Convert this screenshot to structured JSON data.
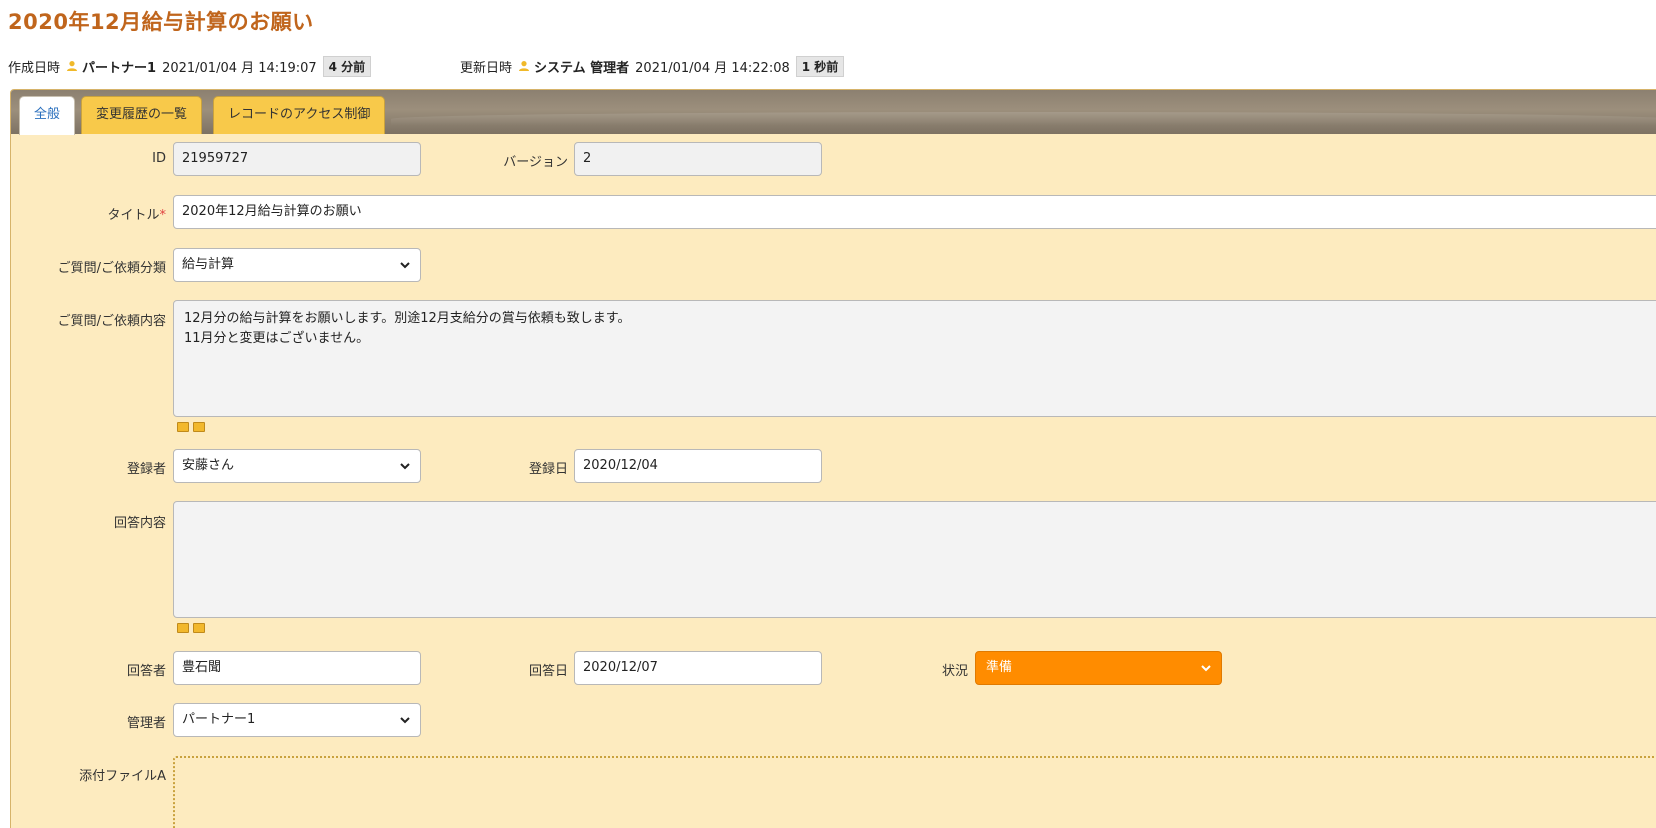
{
  "page": {
    "title": "2020年12月給与計算のお願い"
  },
  "meta": {
    "created_label": "作成日時",
    "created_user": "パートナー1",
    "created_time": "2021/01/04 月 14:19:07",
    "created_ago": "4 分前",
    "updated_label": "更新日時",
    "updated_user": "システム 管理者",
    "updated_time": "2021/01/04 月 14:22:08",
    "updated_ago": "1 秒前",
    "user_icon": "user-icon"
  },
  "tabs": [
    {
      "label": "全般",
      "active": true
    },
    {
      "label": "変更履歴の一覧",
      "active": false
    },
    {
      "label": "レコードのアクセス制御",
      "active": false
    }
  ],
  "form": {
    "id_label": "ID",
    "id_value": "21959727",
    "version_label": "バージョン",
    "version_value": "2",
    "title_label": "タイトル",
    "title_required": "*",
    "title_value": "2020年12月給与計算のお願い",
    "category_label": "ご質問/ご依頼分類",
    "category_value": "給与計算",
    "content_label": "ご質問/ご依頼内容",
    "content_line1": "12月分の給与計算をお願いします。別途12月支給分の賞与依頼も致します。",
    "content_line2": "11月分と変更はございません。",
    "registrant_label": "登録者",
    "registrant_value": "安藤さん",
    "reg_date_label": "登録日",
    "reg_date_value": "2020/12/04",
    "answer_label": "回答内容",
    "answer_value": "",
    "answerer_label": "回答者",
    "answerer_value": "豊石聞",
    "answer_date_label": "回答日",
    "answer_date_value": "2020/12/07",
    "status_label": "状況",
    "status_value": "準備",
    "manager_label": "管理者",
    "manager_value": "パートナー1",
    "attachment_label": "添付ファイルA"
  },
  "colors": {
    "title": "#c0651c",
    "panel": "#fdebbf",
    "tab": "#f8c94a",
    "tab_active_text": "#2a6fbd",
    "status": "#ff8c00",
    "required": "#e04040"
  }
}
